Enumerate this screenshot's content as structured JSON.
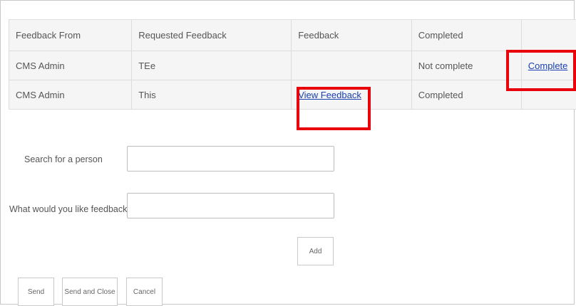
{
  "table": {
    "headers": [
      "Feedback From",
      "Requested Feedback",
      "Feedback",
      "Completed",
      ""
    ],
    "rows": [
      {
        "from": "CMS Admin",
        "requested": "TEe",
        "feedback": "",
        "completed": "Not complete",
        "action": "Complete"
      },
      {
        "from": "CMS Admin",
        "requested": "This",
        "feedback": "View Feedback",
        "completed": "Completed",
        "action": ""
      }
    ]
  },
  "form": {
    "search_label": "Search for a person",
    "search_value": "",
    "feedback_on_label": "What would you like feedback on?",
    "feedback_on_value": "",
    "add_button": "Add"
  },
  "actions": {
    "send": "Send",
    "send_close": "Send and Close",
    "cancel": "Cancel"
  },
  "colors": {
    "highlight": "#e8000b",
    "link": "#1a3fb0",
    "table_bg": "#f5f5f5"
  }
}
